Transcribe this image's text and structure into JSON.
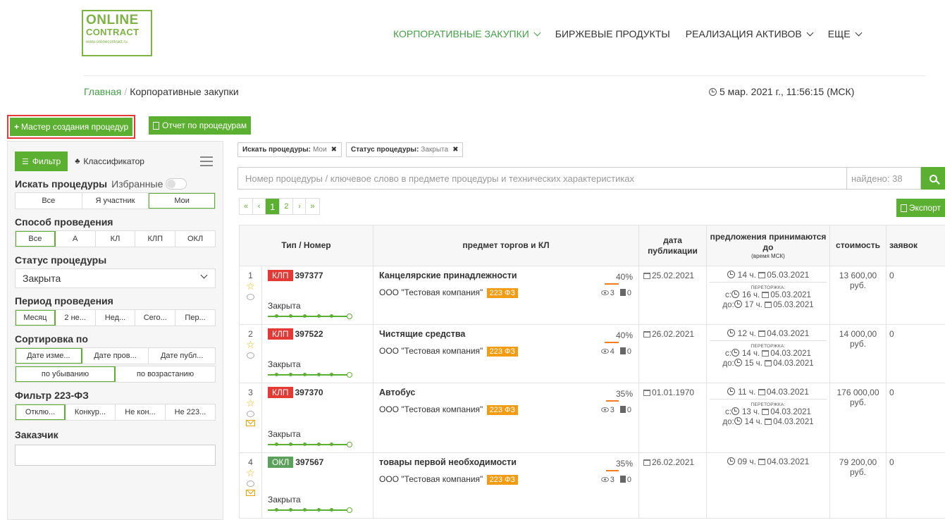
{
  "logo": {
    "line1": "ONLINE",
    "line2": "CONTRACT",
    "line3": "www.onlinecontract.ru"
  },
  "nav": [
    {
      "label": "КОРПОРАТИВНЫЕ ЗАКУПКИ",
      "active": true,
      "dropdown": true
    },
    {
      "label": "БИРЖЕВЫЕ ПРОДУКТЫ",
      "active": false,
      "dropdown": false
    },
    {
      "label": "РЕАЛИЗАЦИЯ АКТИВОВ",
      "active": false,
      "dropdown": true
    },
    {
      "label": "ЕЩЕ",
      "active": false,
      "dropdown": true
    }
  ],
  "breadcrumb": {
    "home": "Главная",
    "separator": "/",
    "current": "Корпоративные закупки"
  },
  "datetime": "5 мар. 2021 г., 11:56:15 (МСК)",
  "toolbar": {
    "master_label": "Мастер создания процедур",
    "report_label": "Отчет по процедурам"
  },
  "sidebar": {
    "tab_filter": "Фильтр",
    "tab_classifier": "Классификатор",
    "search_title": "Искать процедуры",
    "favorites_label": "Избранные",
    "search_options": [
      "Все",
      "Я участник",
      "Мои"
    ],
    "search_selected": 2,
    "method_title": "Способ проведения",
    "method_options": [
      "Все",
      "А",
      "КЛ",
      "КЛП",
      "ОКЛ"
    ],
    "method_selected": 0,
    "status_title": "Статус процедуры",
    "status_value": "Закрыта",
    "period_title": "Период проведения",
    "period_options": [
      "Месяц",
      "2 не...",
      "Нед...",
      "Сего...",
      "Пер..."
    ],
    "period_selected": 0,
    "sort_title": "Сортировка по",
    "sort_options": [
      "Дате изме...",
      "Дате пров...",
      "Дате публ..."
    ],
    "sort_selected": 0,
    "order_options": [
      "по убыванию",
      "по возрастанию"
    ],
    "order_selected": 0,
    "fz_title": "Фильтр 223-ФЗ",
    "fz_options": [
      "Отклю...",
      "Конкур...",
      "Не кон...",
      "Не 223..."
    ],
    "fz_selected": 0,
    "customer_title": "Заказчик"
  },
  "chips": [
    {
      "key": "Искать процедуры:",
      "value": "Мои",
      "close": "✖"
    },
    {
      "key": "Статус процедуры:",
      "value": "Закрыта",
      "close": "✖"
    }
  ],
  "search": {
    "placeholder": "Номер процедуры / ключевое слово в предмете процедуры и технических характеристиках",
    "found": "найдено: 38"
  },
  "pager": [
    "«",
    "‹",
    "1",
    "2",
    "›",
    "»"
  ],
  "pager_current": 2,
  "export_label": "Экспорт",
  "table": {
    "headers": {
      "type": "Тип / Номер",
      "subject": "предмет торгов и КЛ",
      "pub": "дата публикации",
      "deadline": "предложения принимаются до",
      "deadline_note": "(время МСК)",
      "cost": "стоимость",
      "bids": "заявок"
    },
    "retrade_label": "ПЕРЕТОРЖКА:",
    "rows": [
      {
        "n": "1",
        "type": "КЛП",
        "type_class": "klp",
        "number": "397377",
        "status": "Закрыта",
        "mail": false,
        "title": "Канцелярские принадлежности",
        "org": "ООО \"Тестовая компания\"",
        "fz": "223 ФЗ",
        "percent": "40%",
        "percent_value": 40,
        "views": "3",
        "docs": "0",
        "pub_date": "25.02.2021",
        "deadline_time": "14 ч.",
        "deadline_date": "05.03.2021",
        "retrade": true,
        "from_prefix": "с:",
        "from_time": "16 ч.",
        "from_date": "05.03.2021",
        "to_prefix": "до:",
        "to_time": "17 ч.",
        "to_date": "05.03.2021",
        "cost": "13 600,00",
        "currency": "руб.",
        "bids": "0"
      },
      {
        "n": "2",
        "type": "КЛП",
        "type_class": "klp",
        "number": "397522",
        "status": "Закрыта",
        "mail": false,
        "title": "Чистящие средства",
        "org": "ООО \"Тестовая компания\"",
        "fz": "223 ФЗ",
        "percent": "40%",
        "percent_value": 40,
        "views": "4",
        "docs": "0",
        "pub_date": "26.02.2021",
        "deadline_time": "12 ч.",
        "deadline_date": "04.03.2021",
        "retrade": true,
        "from_prefix": "с:",
        "from_time": "14 ч.",
        "from_date": "04.03.2021",
        "to_prefix": "до:",
        "to_time": "15 ч.",
        "to_date": "04.03.2021",
        "cost": "14 000,00",
        "currency": "руб.",
        "bids": "0"
      },
      {
        "n": "3",
        "type": "КЛП",
        "type_class": "klp",
        "number": "397370",
        "status": "Закрыта",
        "mail": true,
        "title": "Автобус",
        "org": "ООО \"Тестовая компания\"",
        "fz": "223 ФЗ",
        "percent": "35%",
        "percent_value": 35,
        "views": "3",
        "docs": "0",
        "pub_date": "01.01.1970",
        "deadline_time": "11 ч.",
        "deadline_date": "04.03.2021",
        "retrade": true,
        "from_prefix": "с:",
        "from_time": "13 ч.",
        "from_date": "04.03.2021",
        "to_prefix": "до:",
        "to_time": "14 ч.",
        "to_date": "04.03.2021",
        "cost": "176 000,00",
        "currency": "руб.",
        "bids": "0"
      },
      {
        "n": "4",
        "type": "ОКЛ",
        "type_class": "okl",
        "number": "397567",
        "status": "Закрыта",
        "mail": true,
        "title": "товары первой необходимости",
        "org": "ООО \"Тестовая компания\"",
        "fz": "223 ФЗ",
        "percent": "35%",
        "percent_value": 35,
        "views": "3",
        "docs": "0",
        "pub_date": "26.02.2021",
        "deadline_time": "09 ч.",
        "deadline_date": "04.03.2021",
        "retrade": false,
        "cost": "79 200,00",
        "currency": "руб.",
        "bids": "0"
      }
    ]
  }
}
